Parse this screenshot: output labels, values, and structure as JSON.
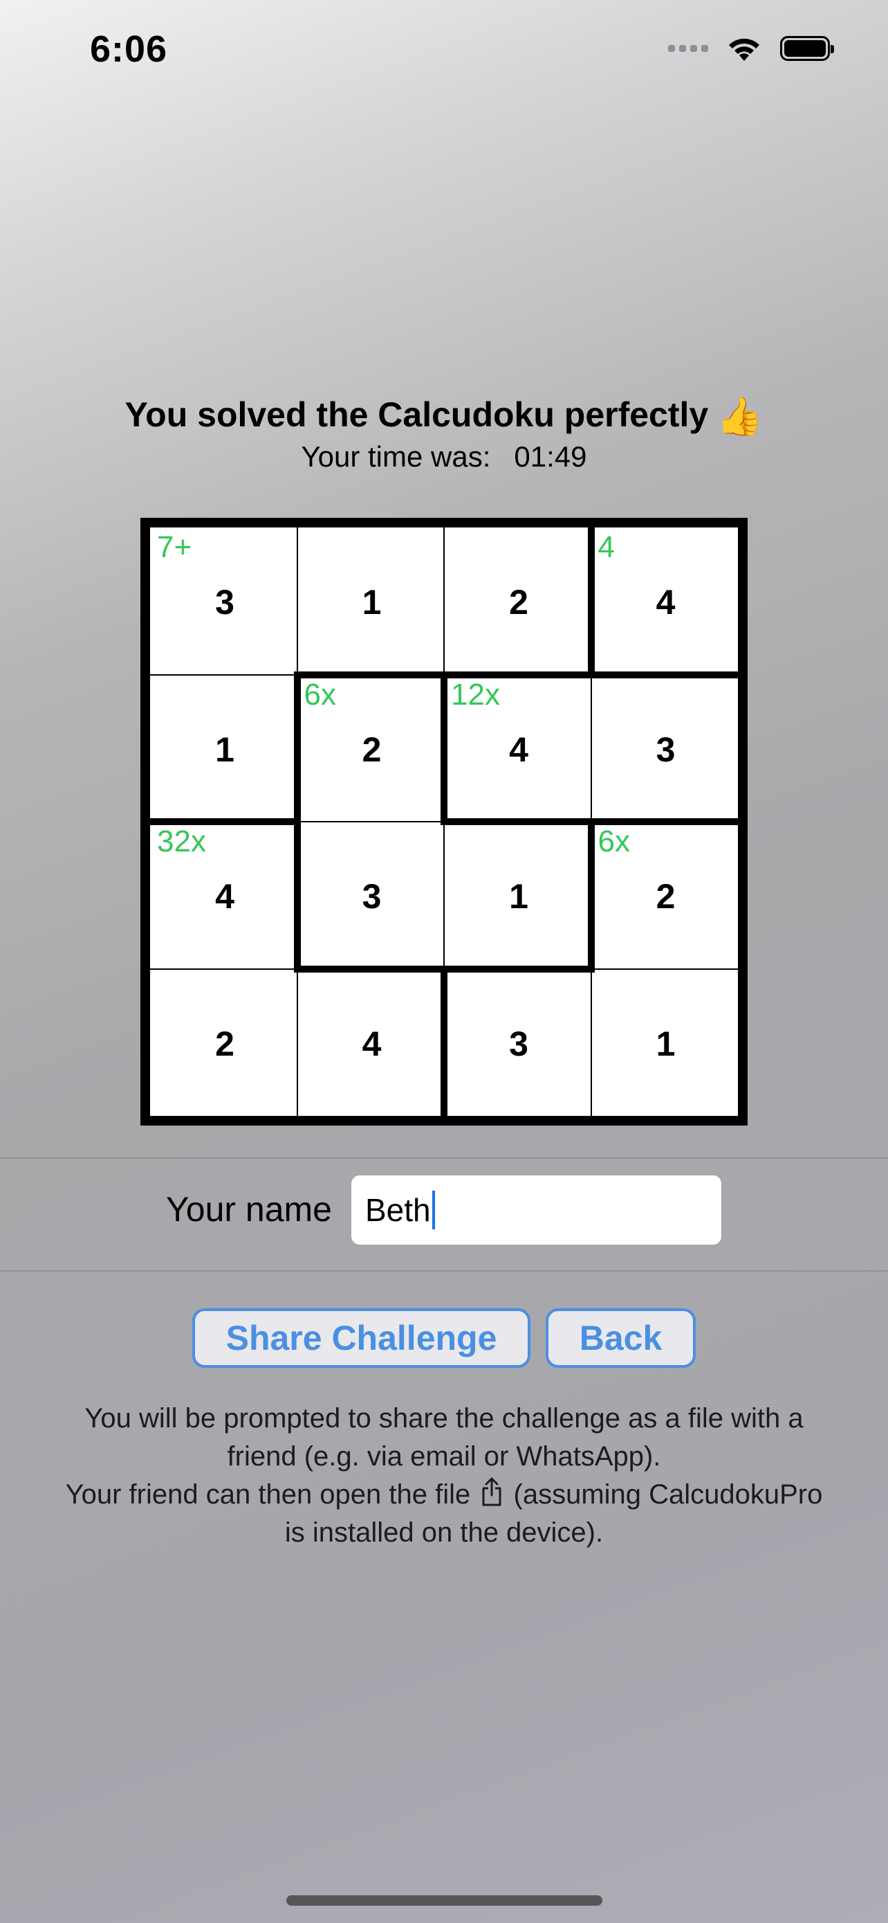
{
  "status_bar": {
    "time": "6:06",
    "icons": [
      "signal-icon",
      "wifi-icon",
      "battery-icon"
    ]
  },
  "result": {
    "headline": "You solved the Calcudoku perfectly",
    "emoji": "👍",
    "time_label": "Your time was:",
    "time_value": "01:49"
  },
  "puzzle": {
    "cells": [
      [
        "3",
        "1",
        "2",
        "4"
      ],
      [
        "1",
        "2",
        "4",
        "3"
      ],
      [
        "4",
        "3",
        "1",
        "2"
      ],
      [
        "2",
        "4",
        "3",
        "1"
      ]
    ],
    "cage_labels": [
      {
        "row": 0,
        "col": 0,
        "label": "7+"
      },
      {
        "row": 0,
        "col": 3,
        "label": "4"
      },
      {
        "row": 1,
        "col": 1,
        "label": "6x"
      },
      {
        "row": 1,
        "col": 2,
        "label": "12x"
      },
      {
        "row": 2,
        "col": 0,
        "label": "32x"
      },
      {
        "row": 2,
        "col": 3,
        "label": "6x"
      }
    ],
    "cage_color": "#34c759"
  },
  "name_form": {
    "label": "Your name",
    "value": "Beth"
  },
  "buttons": {
    "share_label": "Share Challenge",
    "back_label": "Back",
    "accent": "#4a90e2"
  },
  "info": {
    "line1": "You will be prompted to share the challenge as a file with a friend (e.g. via email or WhatsApp).",
    "line2_before": "Your friend can then open the file",
    "line2_icon": "share-icon",
    "line2_after": "(assuming CalcudokuPro is installed on the device)."
  }
}
